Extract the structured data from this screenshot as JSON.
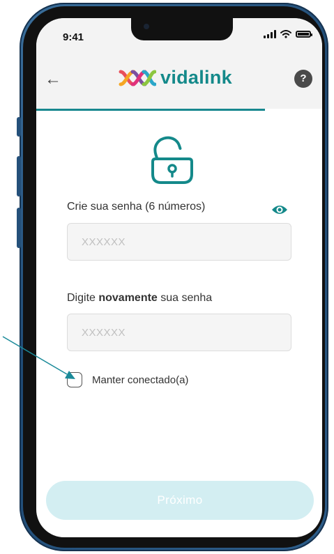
{
  "status_bar": {
    "time": "9:41"
  },
  "header": {
    "logo_text": "vidalink",
    "back_glyph": "←",
    "help_glyph": "?"
  },
  "progress": {
    "fraction": 0.8
  },
  "form": {
    "password_label": "Crie sua senha (6 números)",
    "password_placeholder": "XXXXXX",
    "confirm_label_pre": "Digite ",
    "confirm_label_bold": "novamente",
    "confirm_label_post": " sua senha",
    "confirm_placeholder": "XXXXXX",
    "keep_connected_label": "Manter conectado(a)",
    "keep_connected_checked": false
  },
  "footer": {
    "next_label": "Próximo"
  },
  "colors": {
    "brand": "#14898a",
    "progress": "#18888f",
    "button_disabled": "#d3eef2",
    "annotation_arrow": "#1a8a99"
  },
  "icons": [
    "back-arrow-icon",
    "help-icon",
    "unlock-icon",
    "eye-icon",
    "signal-icon",
    "wifi-icon",
    "battery-icon"
  ]
}
